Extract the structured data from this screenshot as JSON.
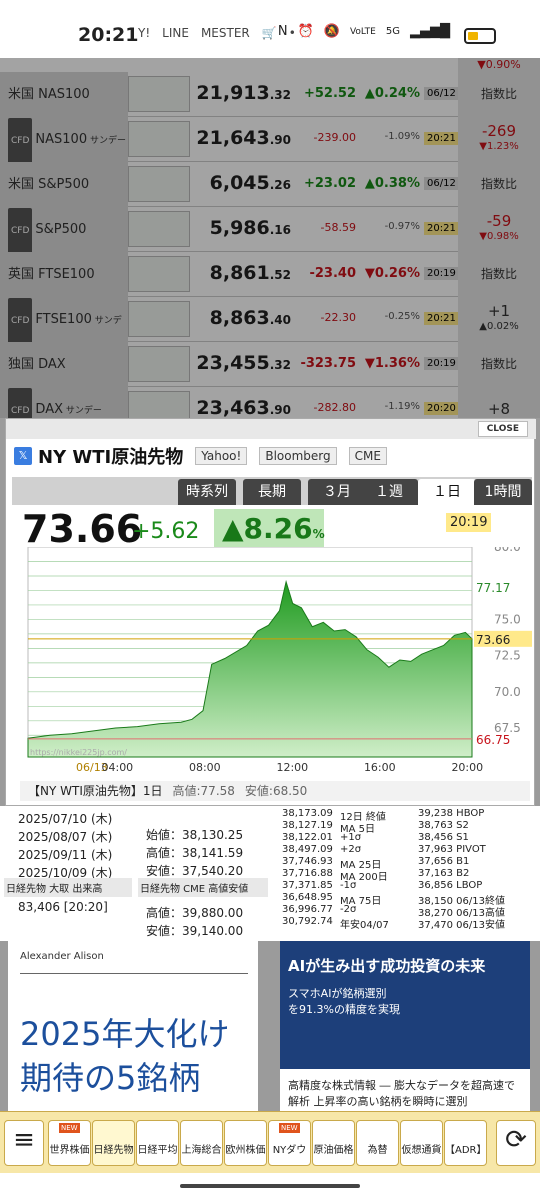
{
  "status": {
    "time": "20:21",
    "icons": [
      "Y!",
      "LINE",
      "MESTER",
      "cart-icon",
      "•"
    ],
    "right": [
      "N",
      "alarm",
      "mute",
      "VoLTE",
      "5G",
      "signal"
    ]
  },
  "market_rows": [
    {
      "name": "米国 NAS100",
      "cfd": false,
      "price_main": "21,913",
      "price_dec": ".32",
      "chg": "+52",
      "chg_dec": ".52",
      "pct": "▲0.24%",
      "time": "06/12",
      "idx": "指数比",
      "dir": "up"
    },
    {
      "name": "NAS100",
      "cfd": true,
      "suffix": "サンデー",
      "price_main": "21,643",
      "price_dec": ".90",
      "chg": "-239",
      "chg_dec": ".00",
      "pct": "-1.09%",
      "time": "20:21",
      "idx": "-269",
      "idx2": "▼1.23%",
      "dir": "dn"
    },
    {
      "name": "米国 S&P500",
      "cfd": false,
      "price_main": "6,045",
      "price_dec": ".26",
      "chg": "+23",
      "chg_dec": ".02",
      "pct": "▲0.38%",
      "time": "06/12",
      "idx": "指数比",
      "dir": "up"
    },
    {
      "name": "S&P500",
      "cfd": true,
      "suffix": "",
      "price_main": "5,986",
      "price_dec": ".16",
      "chg": "-58",
      "chg_dec": ".59",
      "pct": "-0.97%",
      "time": "20:21",
      "idx": "-59",
      "idx2": "▼0.98%",
      "dir": "dn"
    },
    {
      "name": "英国 FTSE100",
      "cfd": false,
      "price_main": "8,861",
      "price_dec": ".52",
      "chg": "-23",
      "chg_dec": ".40",
      "pct": "▼0.26%",
      "time": "20:19",
      "idx": "指数比",
      "dir": "dn"
    },
    {
      "name": "FTSE100",
      "cfd": true,
      "suffix": "サンデー",
      "price_main": "8,863",
      "price_dec": ".40",
      "chg": "-22",
      "chg_dec": ".30",
      "pct": "-0.25%",
      "time": "20:21",
      "idx": "+1",
      "idx2": "▲0.02%",
      "dir": "dn"
    },
    {
      "name": "独国 DAX",
      "cfd": false,
      "price_main": "23,455",
      "price_dec": ".32",
      "chg": "-323",
      "chg_dec": ".75",
      "pct": "▼1.36%",
      "time": "20:19",
      "idx": "指数比",
      "dir": "dn"
    },
    {
      "name": "DAX",
      "cfd": true,
      "suffix": "サンデー",
      "price_main": "23,463",
      "price_dec": ".90",
      "chg": "-282",
      "chg_dec": ".80",
      "pct": "-1.19%",
      "time": "20:20",
      "idx": "+8",
      "dir": "dn"
    }
  ],
  "top_partial": {
    "pct": "▼0.90%"
  },
  "modal": {
    "close": "CLOSE",
    "title": "NY WTI原油先物",
    "sources": [
      "Yahoo!",
      "Bloomberg",
      "CME"
    ],
    "tabs": [
      "時系列",
      "長期",
      "３月",
      "１週",
      "１日",
      "1時間"
    ],
    "active_tab": 4,
    "price": "73.66",
    "change": "+5.62",
    "pct_num": "▲8.26",
    "pct_unit": "%",
    "time": "20:19",
    "footer_title": "【NY WTI原油先物】1日",
    "footer_high": "高値:77.58",
    "footer_low": "安値:68.50",
    "watermark": "https://nikkei225jp.com/"
  },
  "chart_data": {
    "type": "area",
    "title": "",
    "xlabel": "",
    "ylabel": "",
    "x_ticks": [
      "06/13",
      "04:00",
      "08:00",
      "12:00",
      "16:00",
      "20:00"
    ],
    "y_ticks": [
      "67.5",
      "70.0",
      "72.5",
      "75.0",
      "80.0"
    ],
    "ylim": [
      65.5,
      80.0
    ],
    "right_labels": {
      "high": "77.17",
      "current": "73.66",
      "low": "66.75"
    },
    "x_hours": [
      0.0,
      0.5,
      1.0,
      2.0,
      3.0,
      4.0,
      5.0,
      6.0,
      7.0,
      7.5,
      8.0,
      8.4,
      9.0,
      10.0,
      10.5,
      11.0,
      11.5,
      11.8,
      12.1,
      12.5,
      13.0,
      13.5,
      14.0,
      14.5,
      15.0,
      15.5,
      16.0,
      16.5,
      17.0,
      17.5,
      18.0,
      18.5,
      19.0,
      19.5,
      20.0,
      20.3
    ],
    "values": [
      66.8,
      66.9,
      67.0,
      67.1,
      67.3,
      67.5,
      67.6,
      67.8,
      67.9,
      68.1,
      68.7,
      71.9,
      72.3,
      73.2,
      74.2,
      74.6,
      75.6,
      77.6,
      76.1,
      75.8,
      74.5,
      74.8,
      74.2,
      74.3,
      73.8,
      72.9,
      72.4,
      71.7,
      72.2,
      72.1,
      72.6,
      72.9,
      73.2,
      73.9,
      74.1,
      73.66
    ]
  },
  "below": {
    "left_lines": [
      "2025/07/10 (木)",
      "2025/08/07 (木)",
      "2025/09/11 (木)",
      "2025/10/09 (木)"
    ],
    "mid_lines": [
      "始値：38,130.25",
      "高値：38,141.59",
      "安値：37,540.20"
    ],
    "col2": [
      "38,173.09",
      "38,127.19",
      "38,122.01",
      "38,497.09",
      "37,746.93",
      "37,716.88",
      "37,371.85",
      "36,648.95",
      "36,996.77",
      "30,792.74"
    ],
    "col3": [
      "12日 終値",
      "MA 5日",
      "+1σ",
      "+2σ",
      "MA 25日",
      "MA 200日",
      "-1σ",
      "MA 75日",
      "-2σ",
      "年安04/07"
    ],
    "col4": [
      "39,238 HBOP",
      "38,763 S2",
      "38,456 S1",
      "37,963 PIVOT",
      "37,656 B1",
      "37,163 B2",
      "36,856 LBOP",
      "38,150 06/13終値",
      "38,270 06/13高値",
      "37,470 06/13安値"
    ],
    "h1": "日経先物 大取 出来高",
    "h2": "日経先物 CME 高値安値",
    "vol": "83,406 [20:20]",
    "cme_high": "高値：39,880.00",
    "cme_low": "安値：39,140.00"
  },
  "ad1": {
    "author": "Alexander Alison",
    "headline1": "2025年大化け",
    "headline2": "期待の5銘柄"
  },
  "ad2": {
    "title": "AIが生み出す成功投資の未来",
    "line1": "スマホAIが銘柄選別",
    "line2": "を91.3%の精度を実現",
    "caption1": "高精度な株式情報 ― 膨大なデータを超高速で",
    "caption2": "解析 上昇率の高い銘柄を瞬時に選別"
  },
  "nav": {
    "menu": "≡",
    "items": [
      "世界株価",
      "日経先物",
      "日経平均",
      "上海総合",
      "欧州株価",
      "NYダウ",
      "原油価格",
      "為替",
      "仮想通貨",
      "【ADR】"
    ],
    "new_badges": [
      "NEW",
      "NEW"
    ],
    "active": 1,
    "refresh": "⟳"
  }
}
